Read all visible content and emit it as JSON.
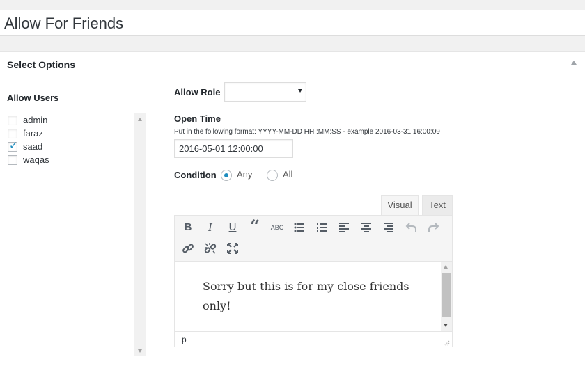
{
  "post": {
    "title": "Allow For Friends"
  },
  "panel": {
    "title": "Select Options"
  },
  "users": {
    "label": "Allow Users",
    "items": [
      {
        "name": "admin",
        "checked": false
      },
      {
        "name": "faraz",
        "checked": false
      },
      {
        "name": "saad",
        "checked": true
      },
      {
        "name": "waqas",
        "checked": false
      }
    ]
  },
  "role": {
    "label": "Allow Role",
    "selected": ""
  },
  "open_time": {
    "label": "Open Time",
    "hint": "Put in the following format: YYYY-MM-DD HH::MM:SS - example 2016-03-31 16:00:09",
    "value": "2016-05-01 12:00:00"
  },
  "condition": {
    "label": "Condition",
    "options": [
      {
        "label": "Any",
        "selected": true
      },
      {
        "label": "All",
        "selected": false
      }
    ]
  },
  "editor": {
    "tabs": {
      "visual": "Visual",
      "text": "Text"
    },
    "content": "Sorry but this is for my close friends only!",
    "status_path": "p",
    "toolbar_icons": [
      "bold-icon",
      "italic-icon",
      "underline-icon",
      "blockquote-icon",
      "strikethrough-icon",
      "bullet-list-icon",
      "numbered-list-icon",
      "align-left-icon",
      "align-center-icon",
      "align-right-icon",
      "undo-icon",
      "redo-icon",
      "link-icon",
      "unlink-icon",
      "fullscreen-icon"
    ]
  },
  "colors": {
    "accent": "#1e8cbe"
  }
}
